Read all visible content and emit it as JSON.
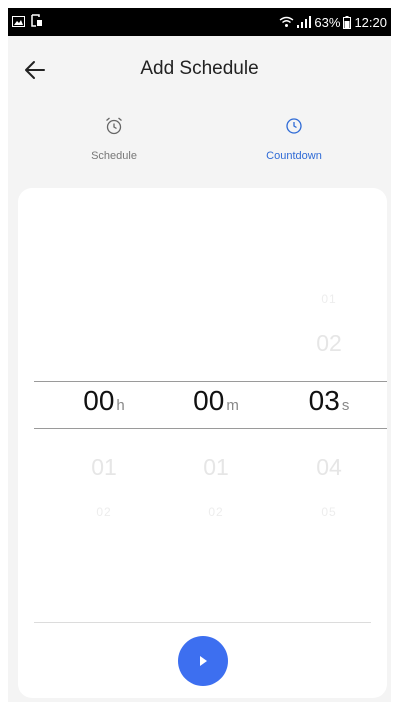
{
  "status_bar": {
    "battery": "63%",
    "time": "12:20",
    "left_icons": [
      "image-icon",
      "screenshot-icon"
    ],
    "right_icons": [
      "wifi-icon",
      "signal-icon",
      "battery-icon"
    ]
  },
  "header": {
    "title": "Add Schedule",
    "back_icon": "back-arrow-icon"
  },
  "tabs": [
    {
      "label": "Schedule",
      "icon": "alarm-clock-icon",
      "active": false
    },
    {
      "label": "Countdown",
      "icon": "clock-icon",
      "active": true
    }
  ],
  "picker": {
    "hours": {
      "above": [
        "",
        ""
      ],
      "selected": "00",
      "unit": "h",
      "below": [
        "01",
        "02"
      ]
    },
    "minutes": {
      "above": [
        "",
        ""
      ],
      "selected": "00",
      "unit": "m",
      "below": [
        "01",
        "02"
      ]
    },
    "seconds": {
      "above": [
        "01",
        "02"
      ],
      "selected": "03",
      "unit": "s",
      "below": [
        "04",
        "05"
      ]
    }
  },
  "play_button": {
    "icon": "play-icon"
  },
  "colors": {
    "accent": "#3d6ff0",
    "tab_active": "#2f6bd6",
    "background": "#f4f4f4"
  }
}
